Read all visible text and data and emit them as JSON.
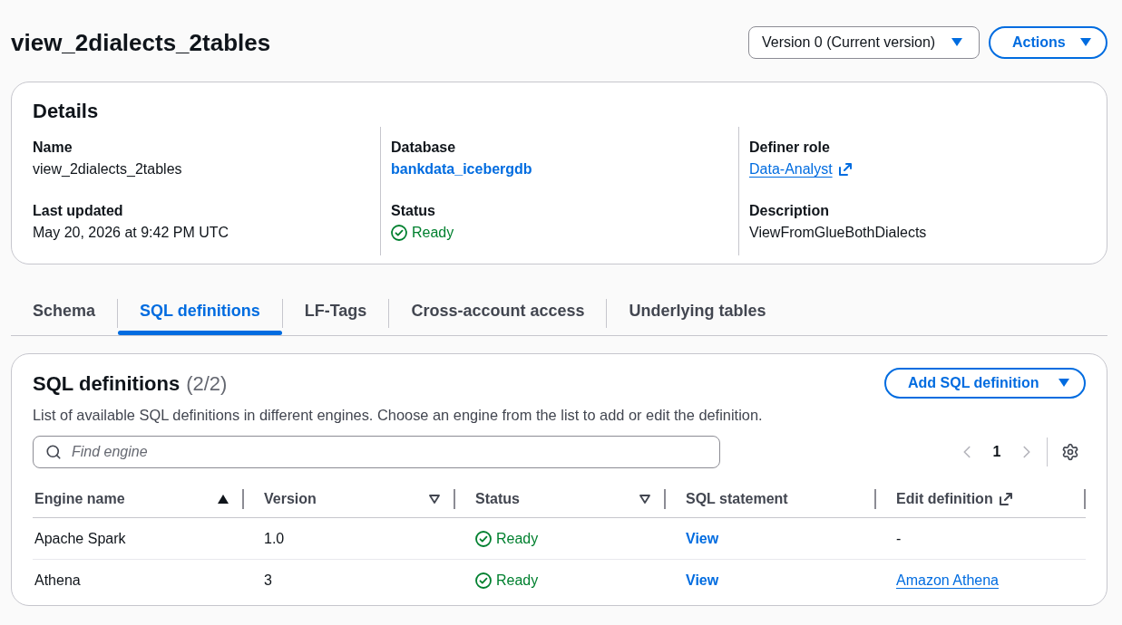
{
  "header": {
    "title": "view_2dialects_2tables",
    "version_select": {
      "value": "Version 0 (Current version)"
    },
    "actions_button": {
      "label": "Actions"
    }
  },
  "details": {
    "title": "Details",
    "columns": [
      {
        "fields": [
          {
            "label": "Name",
            "value": "view_2dialects_2tables",
            "kind": "text"
          },
          {
            "label": "Last updated",
            "value": "May 20, 2026 at 9:42 PM UTC",
            "kind": "text"
          }
        ]
      },
      {
        "fields": [
          {
            "label": "Database",
            "value": "bankdata_icebergdb",
            "kind": "link"
          },
          {
            "label": "Status",
            "value": "Ready",
            "kind": "status_success"
          }
        ]
      },
      {
        "fields": [
          {
            "label": "Definer role",
            "value": "Data-Analyst",
            "kind": "external_link"
          },
          {
            "label": "Description",
            "value": "ViewFromGlueBothDialects",
            "kind": "text"
          }
        ]
      }
    ]
  },
  "tabs": [
    {
      "label": "Schema",
      "selected": false
    },
    {
      "label": "SQL definitions",
      "selected": true
    },
    {
      "label": "LF-Tags",
      "selected": false
    },
    {
      "label": "Cross-account access",
      "selected": false
    },
    {
      "label": "Underlying tables",
      "selected": false
    }
  ],
  "sql_definitions": {
    "title": "SQL definitions",
    "count": "(2/2)",
    "add_button": {
      "label": "Add SQL definition"
    },
    "description": "List of available SQL definitions in different engines. Choose an engine from the list to add or edit the definition.",
    "search": {
      "placeholder": "Find engine"
    },
    "pagination": {
      "previous_disabled": true,
      "pages": [
        {
          "label": "1",
          "selected": true
        }
      ],
      "next_disabled": true
    },
    "columns": [
      {
        "label": "Engine name",
        "sortable": true,
        "sorted": true
      },
      {
        "label": "Version",
        "sortable": true,
        "sorted": false
      },
      {
        "label": "Status",
        "sortable": true,
        "sorted": false
      },
      {
        "label": "SQL statement",
        "sortable": false
      },
      {
        "label": "Edit definition",
        "sortable": false,
        "external": true
      }
    ],
    "rows": [
      {
        "engine_name": "Apache Spark",
        "version": "1.0",
        "status": {
          "text": "Ready",
          "kind": "success"
        },
        "sql_statement": "View",
        "edit_definition": {
          "text": "-",
          "kind": "text"
        }
      },
      {
        "engine_name": "Athena",
        "version": "3",
        "status": {
          "text": "Ready",
          "kind": "success"
        },
        "sql_statement": "View",
        "edit_definition": {
          "text": "Amazon Athena",
          "kind": "link"
        }
      }
    ]
  }
}
